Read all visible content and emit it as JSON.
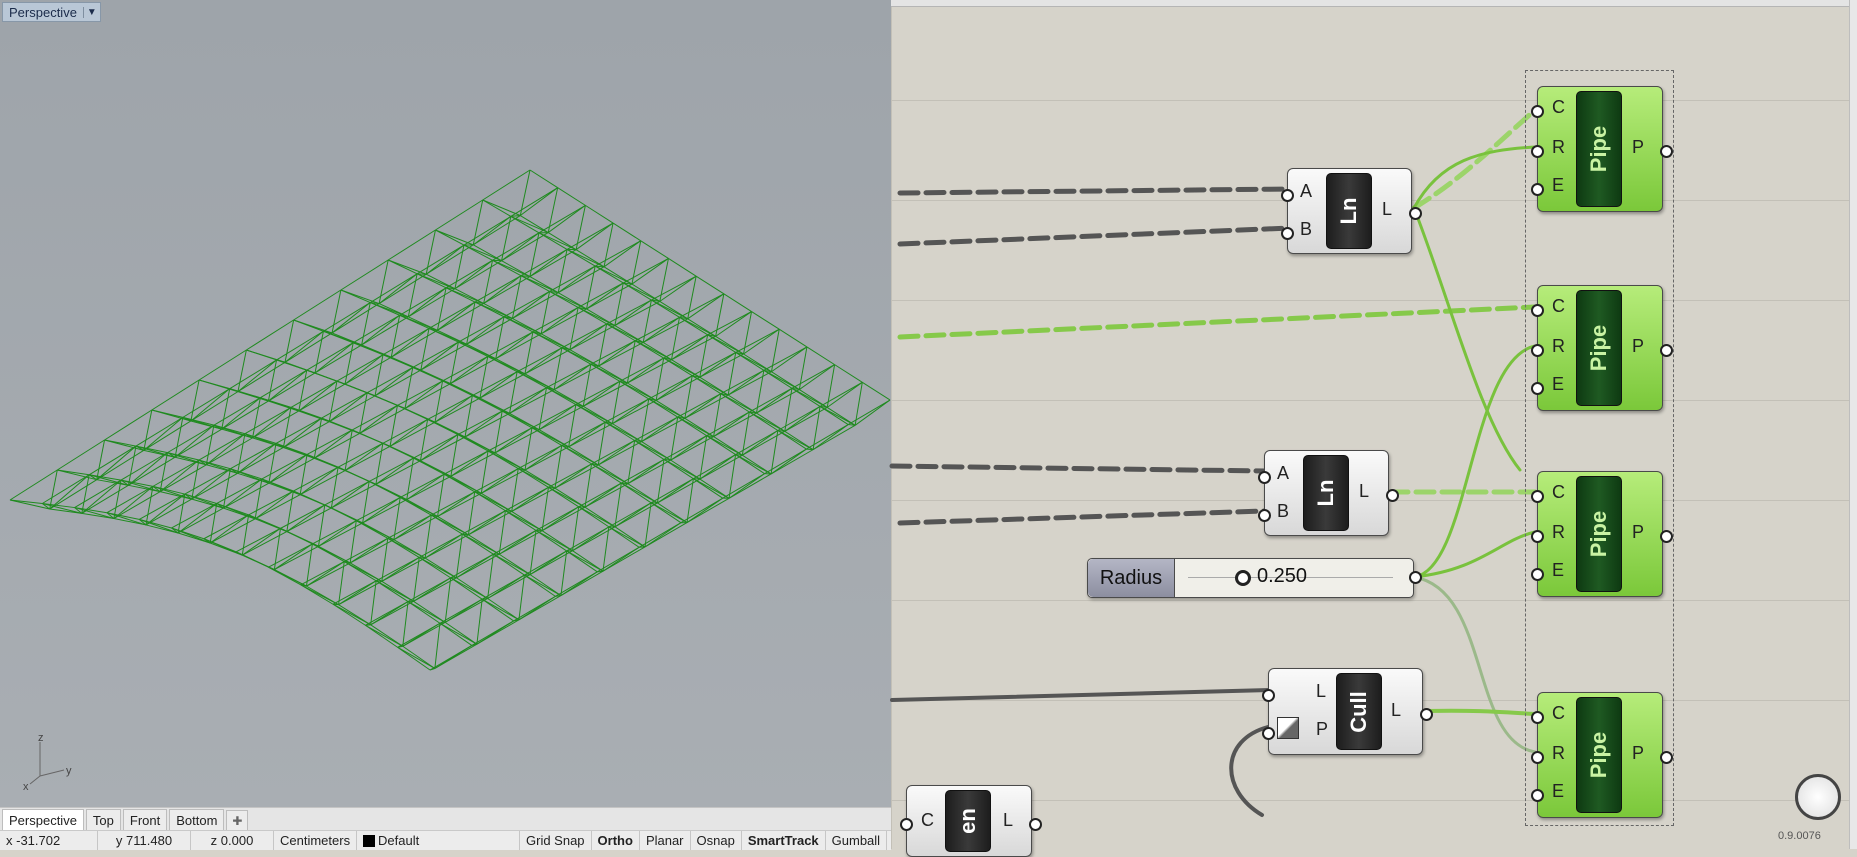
{
  "viewport": {
    "title": "Perspective",
    "tabs": [
      "Perspective",
      "Top",
      "Front",
      "Bottom"
    ],
    "axis": {
      "z": "z",
      "y": "y",
      "x": "x"
    },
    "wire_color": "#1f8a1f"
  },
  "status": {
    "x": "x -31.702",
    "y": "y 711.480",
    "z": "z 0.000",
    "units": "Centimeters",
    "layer": "Default",
    "toggles": [
      "Grid Snap",
      "Ortho",
      "Planar",
      "Osnap",
      "SmartTrack",
      "Gumball"
    ]
  },
  "grasshopper": {
    "ln1": {
      "inputs": [
        "A",
        "B"
      ],
      "name": "Ln",
      "output": "L"
    },
    "ln2": {
      "inputs": [
        "A",
        "B"
      ],
      "name": "Ln",
      "output": "L"
    },
    "pipes": [
      {
        "inputs": [
          "C",
          "R",
          "E"
        ],
        "name": "Pipe",
        "output": "P"
      },
      {
        "inputs": [
          "C",
          "R",
          "E"
        ],
        "name": "Pipe",
        "output": "P"
      },
      {
        "inputs": [
          "C",
          "R",
          "E"
        ],
        "name": "Pipe",
        "output": "P"
      },
      {
        "inputs": [
          "C",
          "R",
          "E"
        ],
        "name": "Pipe",
        "output": "P"
      }
    ],
    "slider": {
      "label": "Radius",
      "value": "0.250"
    },
    "cull": {
      "inputs": [
        "L",
        "P"
      ],
      "name": "Cull",
      "output": "L"
    },
    "partial": {
      "input": "C",
      "name": "en",
      "output": "L"
    },
    "version": "0.9.0076",
    "colors": {
      "active_wire": "#86c94a",
      "inactive_wire": "#555555",
      "component_green": "#8fd94a"
    }
  }
}
